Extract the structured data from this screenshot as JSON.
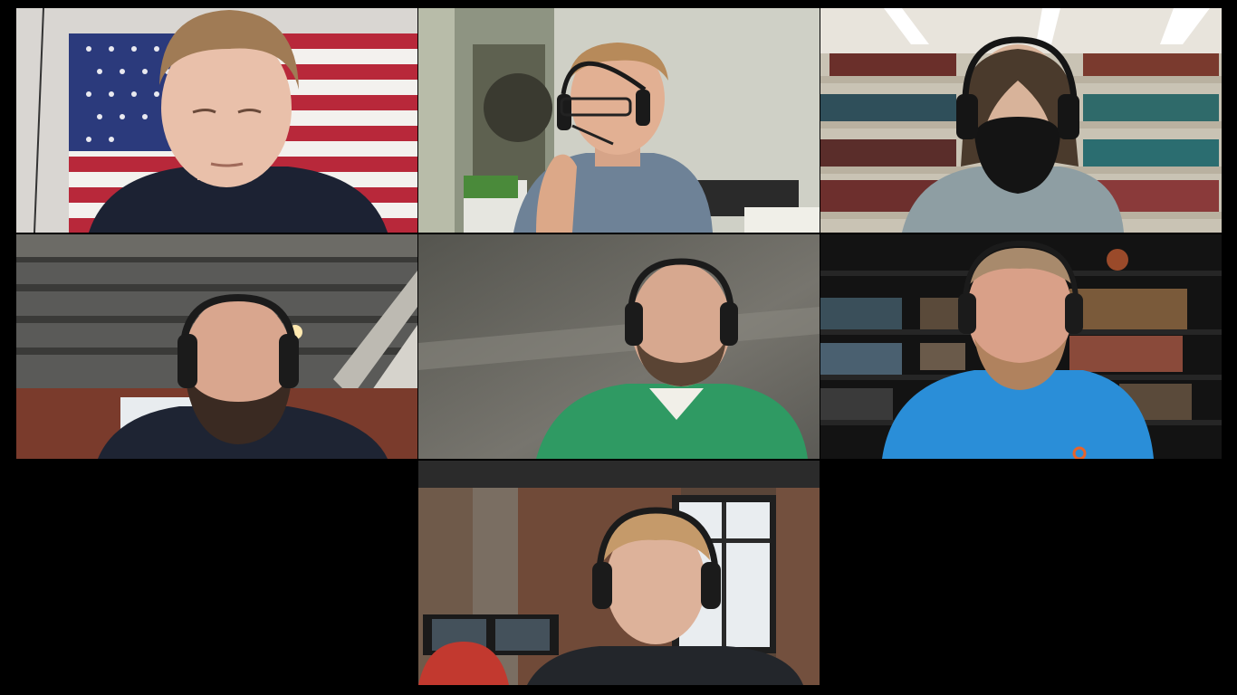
{
  "meeting": {
    "layout": "gallery",
    "participant_count": 7,
    "participants": [
      {
        "scene": "american-flag-background",
        "shirt_color": "#1c2233"
      },
      {
        "scene": "closet-room-headset",
        "shirt_color": "#6e8297"
      },
      {
        "scene": "library-shelves-mask",
        "shirt_color": "#8e9ea3"
      },
      {
        "scene": "industrial-loft-headset",
        "shirt_color": "#1e2433"
      },
      {
        "scene": "blurred-office-headset",
        "shirt_color": "#2f9a63"
      },
      {
        "scene": "dark-bookshelf",
        "shirt_color": "#2a8ed8"
      },
      {
        "scene": "brick-window-headset",
        "shirt_color": "#23262b"
      }
    ]
  }
}
